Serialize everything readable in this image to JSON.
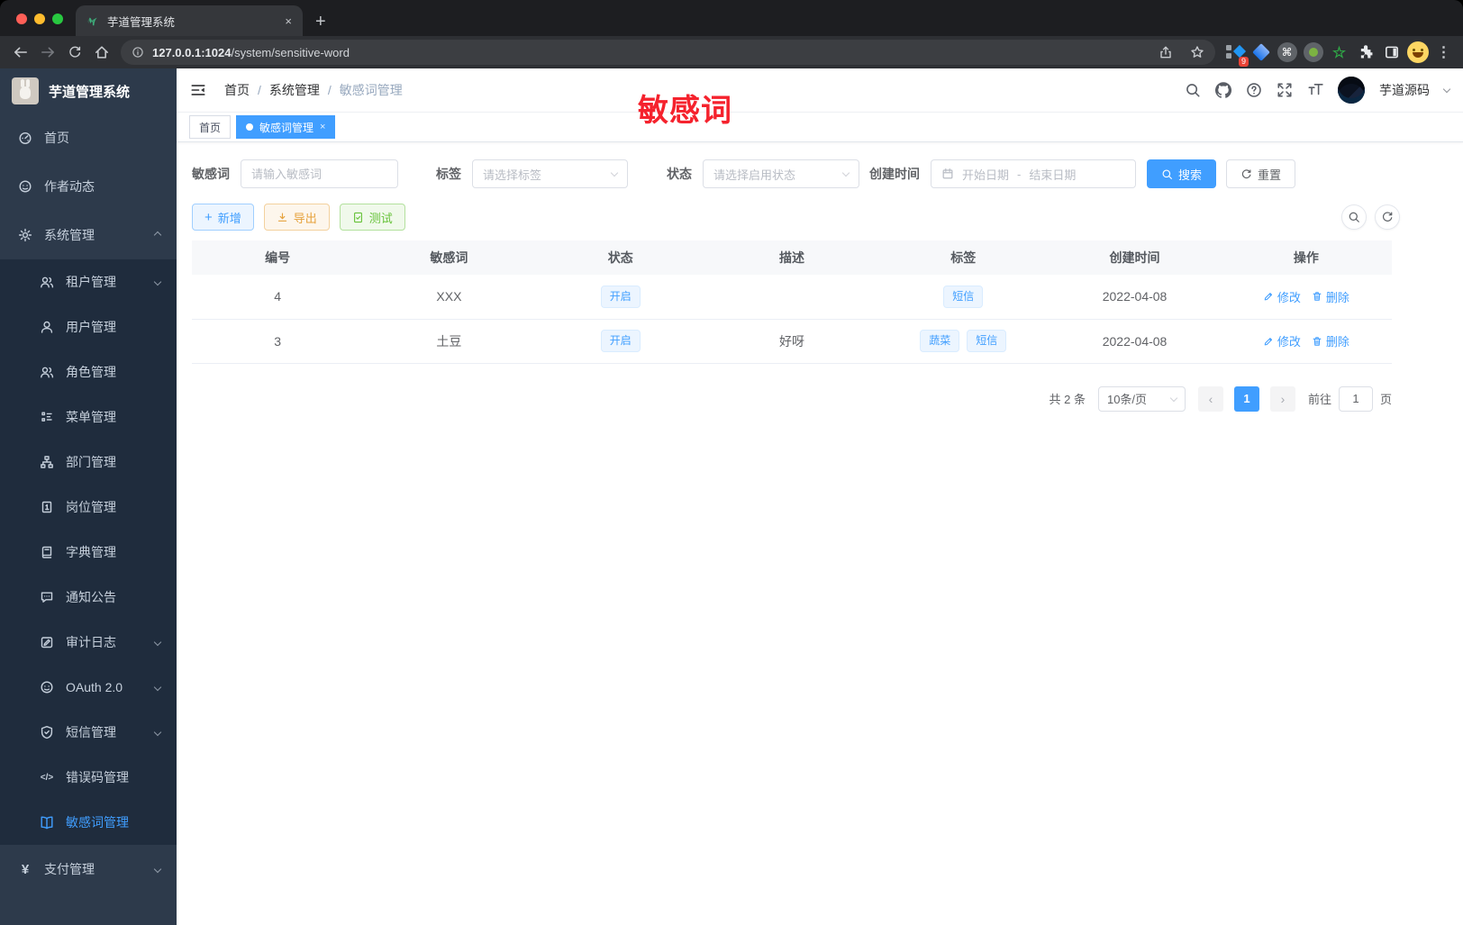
{
  "browser": {
    "tab_title": "芋道管理系统",
    "url_host": "127.0.0.1:1024",
    "url_path": "/system/sensitive-word",
    "ext_badge": "9"
  },
  "icons": {
    "close": "×",
    "plus": "+",
    "command": "⌘",
    "green_star": "☆",
    "dots_menu": "⋮",
    "page_prev": "‹",
    "page_next": "›",
    "yen": "¥",
    "code": "</>",
    "range_sep": "-"
  },
  "sidebar": {
    "title": "芋道管理系统",
    "items": [
      {
        "label": "首页"
      },
      {
        "label": "作者动态"
      },
      {
        "label": "系统管理"
      },
      {
        "label": "租户管理"
      },
      {
        "label": "用户管理"
      },
      {
        "label": "角色管理"
      },
      {
        "label": "菜单管理"
      },
      {
        "label": "部门管理"
      },
      {
        "label": "岗位管理"
      },
      {
        "label": "字典管理"
      },
      {
        "label": "通知公告"
      },
      {
        "label": "审计日志"
      },
      {
        "label": "OAuth 2.0"
      },
      {
        "label": "短信管理"
      },
      {
        "label": "错误码管理"
      },
      {
        "label": "敏感词管理"
      },
      {
        "label": "支付管理"
      }
    ]
  },
  "header": {
    "breadcrumb": [
      "首页",
      "系统管理",
      "敏感词管理"
    ],
    "separator": "/",
    "username": "芋道源码"
  },
  "annotation": {
    "text": "敏感词"
  },
  "tabs": {
    "home": "首页",
    "active": "敏感词管理"
  },
  "filters": {
    "word_label": "敏感词",
    "word_placeholder": "请输入敏感词",
    "tag_label": "标签",
    "tag_placeholder": "请选择标签",
    "status_label": "状态",
    "status_placeholder": "请选择启用状态",
    "time_label": "创建时间",
    "start_placeholder": "开始日期",
    "end_placeholder": "结束日期",
    "search_label": "搜索",
    "reset_label": "重置"
  },
  "toolbar": {
    "add_label": "新增",
    "export_label": "导出",
    "test_label": "测试"
  },
  "table": {
    "columns": [
      "编号",
      "敏感词",
      "状态",
      "描述",
      "标签",
      "创建时间",
      "操作"
    ],
    "rows": [
      {
        "id": "4",
        "word": "XXX",
        "status": "开启",
        "desc": "",
        "tags": [
          "短信"
        ],
        "created": "2022-04-08",
        "edit_label": "修改",
        "delete_label": "删除"
      },
      {
        "id": "3",
        "word": "土豆",
        "status": "开启",
        "desc": "好呀",
        "tags": [
          "蔬菜",
          "短信"
        ],
        "created": "2022-04-08",
        "edit_label": "修改",
        "delete_label": "删除"
      }
    ]
  },
  "pagination": {
    "total": "共 2 条",
    "page_size": "10条/页",
    "current_page": "1",
    "goto_label": "前往",
    "goto_value": "1",
    "page_unit": "页"
  },
  "colors": {
    "accent": "#409eff",
    "annotation_red": "#f5222d",
    "sidebar_bg": "#2d3a4b",
    "submenu_bg": "#1f2c3d"
  }
}
